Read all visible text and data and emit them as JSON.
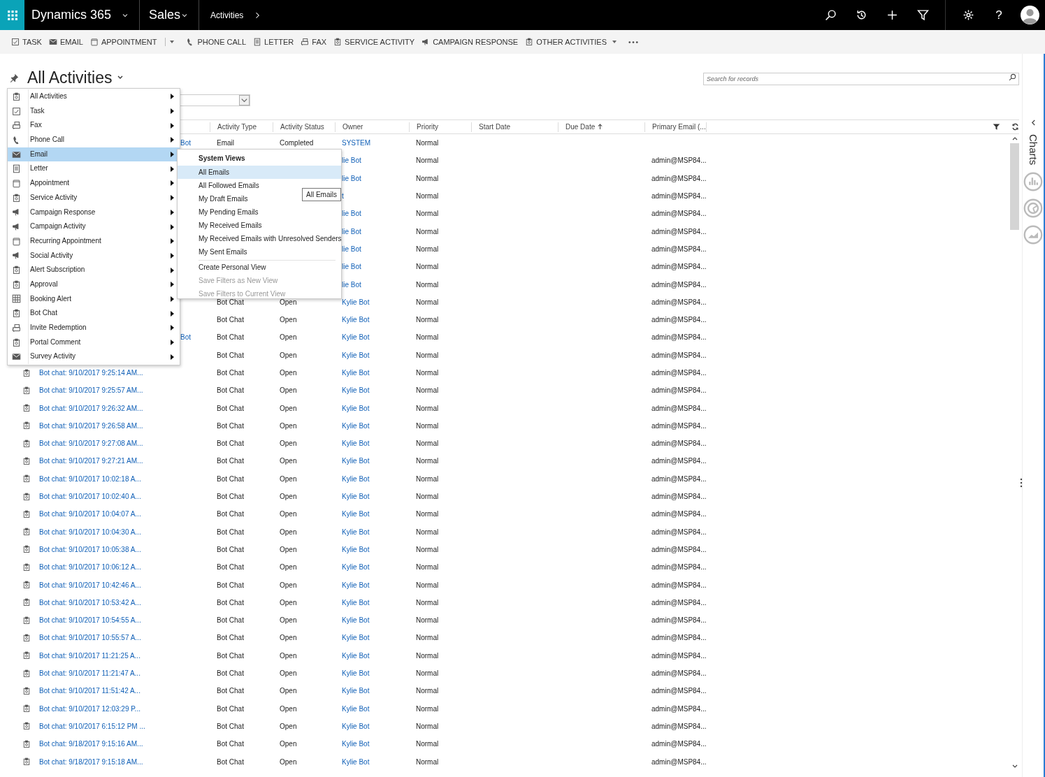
{
  "nav": {
    "app": "Dynamics 365",
    "area": "Sales",
    "entity": "Activities",
    "help": "?"
  },
  "commands": [
    {
      "label": "TASK",
      "kind": "button"
    },
    {
      "label": "EMAIL",
      "kind": "button"
    },
    {
      "label": "APPOINTMENT",
      "kind": "split"
    },
    {
      "label": "PHONE CALL",
      "kind": "button"
    },
    {
      "label": "LETTER",
      "kind": "button"
    },
    {
      "label": "FAX",
      "kind": "button"
    },
    {
      "label": "SERVICE ACTIVITY",
      "kind": "button"
    },
    {
      "label": "CAMPAIGN RESPONSE",
      "kind": "button"
    },
    {
      "label": "OTHER ACTIVITIES",
      "kind": "menu"
    }
  ],
  "view": {
    "title": "All Activities"
  },
  "search": {
    "placeholder": "Search for records"
  },
  "grid": {
    "columns": [
      {
        "label": "Activity Type",
        "sorted": false
      },
      {
        "label": "Activity Status",
        "sorted": false
      },
      {
        "label": "Owner",
        "sorted": false
      },
      {
        "label": "Priority",
        "sorted": false
      },
      {
        "label": "Start Date",
        "sorted": false
      },
      {
        "label": "Due Date",
        "sorted": true
      },
      {
        "label": "Primary Email (...",
        "sorted": false
      }
    ],
    "rows": [
      {
        "kind": "partial",
        "subject": "Bot",
        "type": "Email",
        "status": "Completed",
        "owner": "SYSTEM",
        "priority": "Normal"
      },
      {
        "kind": "partial",
        "owner": "lie Bot",
        "priority": "Normal",
        "email": "admin@MSP84..."
      },
      {
        "kind": "partial",
        "owner": "lie Bot",
        "priority": "Normal",
        "email": "admin@MSP84..."
      },
      {
        "kind": "partial",
        "owner": "t",
        "priority": "Normal",
        "email": "admin@MSP84..."
      },
      {
        "kind": "partial",
        "owner": "lie Bot",
        "priority": "Normal",
        "email": "admin@MSP84..."
      },
      {
        "kind": "partial",
        "owner": "lie Bot",
        "priority": "Normal",
        "email": "admin@MSP84..."
      },
      {
        "kind": "partial",
        "owner": "lie Bot",
        "priority": "Normal",
        "email": "admin@MSP84..."
      },
      {
        "kind": "partial",
        "owner": "lie Bot",
        "priority": "Normal",
        "email": "admin@MSP84..."
      },
      {
        "kind": "partial",
        "owner": "lie Bot",
        "priority": "Normal",
        "email": "admin@MSP84..."
      },
      {
        "kind": "partial",
        "type": "Bot Chat",
        "status": "Open",
        "owner": "Kylie Bot",
        "priority": "Normal",
        "email": "admin@MSP84..."
      },
      {
        "kind": "partial",
        "type": "Bot Chat",
        "status": "Open",
        "owner": "Kylie Bot",
        "priority": "Normal",
        "email": "admin@MSP84..."
      },
      {
        "kind": "partial",
        "subject": "Bot",
        "type": "Bot Chat",
        "status": "Open",
        "owner": "Kylie Bot",
        "priority": "Normal",
        "email": "admin@MSP84..."
      },
      {
        "kind": "partial",
        "type": "Bot Chat",
        "status": "Open",
        "owner": "Kylie Bot",
        "priority": "Normal",
        "email": "admin@MSP84..."
      },
      {
        "kind": "full",
        "subject": "Bot chat: 9/10/2017 9:25:14 AM...",
        "type": "Bot Chat",
        "status": "Open",
        "owner": "Kylie Bot",
        "priority": "Normal",
        "email": "admin@MSP84..."
      },
      {
        "kind": "full",
        "subject": "Bot chat: 9/10/2017 9:25:57 AM...",
        "type": "Bot Chat",
        "status": "Open",
        "owner": "Kylie Bot",
        "priority": "Normal",
        "email": "admin@MSP84..."
      },
      {
        "kind": "full",
        "subject": "Bot chat: 9/10/2017 9:26:32 AM...",
        "type": "Bot Chat",
        "status": "Open",
        "owner": "Kylie Bot",
        "priority": "Normal",
        "email": "admin@MSP84..."
      },
      {
        "kind": "full",
        "subject": "Bot chat: 9/10/2017 9:26:58 AM...",
        "type": "Bot Chat",
        "status": "Open",
        "owner": "Kylie Bot",
        "priority": "Normal",
        "email": "admin@MSP84..."
      },
      {
        "kind": "full",
        "subject": "Bot chat: 9/10/2017 9:27:08 AM...",
        "type": "Bot Chat",
        "status": "Open",
        "owner": "Kylie Bot",
        "priority": "Normal",
        "email": "admin@MSP84..."
      },
      {
        "kind": "full",
        "subject": "Bot chat: 9/10/2017 9:27:21 AM...",
        "type": "Bot Chat",
        "status": "Open",
        "owner": "Kylie Bot",
        "priority": "Normal",
        "email": "admin@MSP84..."
      },
      {
        "kind": "full",
        "subject": "Bot chat: 9/10/2017 10:02:18 A...",
        "type": "Bot Chat",
        "status": "Open",
        "owner": "Kylie Bot",
        "priority": "Normal",
        "email": "admin@MSP84..."
      },
      {
        "kind": "full",
        "subject": "Bot chat: 9/10/2017 10:02:40 A...",
        "type": "Bot Chat",
        "status": "Open",
        "owner": "Kylie Bot",
        "priority": "Normal",
        "email": "admin@MSP84..."
      },
      {
        "kind": "full",
        "subject": "Bot chat: 9/10/2017 10:04:07 A...",
        "type": "Bot Chat",
        "status": "Open",
        "owner": "Kylie Bot",
        "priority": "Normal",
        "email": "admin@MSP84..."
      },
      {
        "kind": "full",
        "subject": "Bot chat: 9/10/2017 10:04:30 A...",
        "type": "Bot Chat",
        "status": "Open",
        "owner": "Kylie Bot",
        "priority": "Normal",
        "email": "admin@MSP84..."
      },
      {
        "kind": "full",
        "subject": "Bot chat: 9/10/2017 10:05:38 A...",
        "type": "Bot Chat",
        "status": "Open",
        "owner": "Kylie Bot",
        "priority": "Normal",
        "email": "admin@MSP84..."
      },
      {
        "kind": "full",
        "subject": "Bot chat: 9/10/2017 10:06:12 A...",
        "type": "Bot Chat",
        "status": "Open",
        "owner": "Kylie Bot",
        "priority": "Normal",
        "email": "admin@MSP84..."
      },
      {
        "kind": "full",
        "subject": "Bot chat: 9/10/2017 10:42:46 A...",
        "type": "Bot Chat",
        "status": "Open",
        "owner": "Kylie Bot",
        "priority": "Normal",
        "email": "admin@MSP84..."
      },
      {
        "kind": "full",
        "subject": "Bot chat: 9/10/2017 10:53:42 A...",
        "type": "Bot Chat",
        "status": "Open",
        "owner": "Kylie Bot",
        "priority": "Normal",
        "email": "admin@MSP84..."
      },
      {
        "kind": "full",
        "subject": "Bot chat: 9/10/2017 10:54:55 A...",
        "type": "Bot Chat",
        "status": "Open",
        "owner": "Kylie Bot",
        "priority": "Normal",
        "email": "admin@MSP84..."
      },
      {
        "kind": "full",
        "subject": "Bot chat: 9/10/2017 10:55:57 A...",
        "type": "Bot Chat",
        "status": "Open",
        "owner": "Kylie Bot",
        "priority": "Normal",
        "email": "admin@MSP84..."
      },
      {
        "kind": "full",
        "subject": "Bot chat: 9/10/2017 11:21:25 A...",
        "type": "Bot Chat",
        "status": "Open",
        "owner": "Kylie Bot",
        "priority": "Normal",
        "email": "admin@MSP84..."
      },
      {
        "kind": "full",
        "subject": "Bot chat: 9/10/2017 11:21:47 A...",
        "type": "Bot Chat",
        "status": "Open",
        "owner": "Kylie Bot",
        "priority": "Normal",
        "email": "admin@MSP84..."
      },
      {
        "kind": "full",
        "subject": "Bot chat: 9/10/2017 11:51:42 A...",
        "type": "Bot Chat",
        "status": "Open",
        "owner": "Kylie Bot",
        "priority": "Normal",
        "email": "admin@MSP84..."
      },
      {
        "kind": "full",
        "subject": "Bot chat: 9/10/2017 12:03:29 P...",
        "type": "Bot Chat",
        "status": "Open",
        "owner": "Kylie Bot",
        "priority": "Normal",
        "email": "admin@MSP84..."
      },
      {
        "kind": "full",
        "subject": "Bot chat: 9/10/2017 6:15:12 PM ...",
        "type": "Bot Chat",
        "status": "Open",
        "owner": "Kylie Bot",
        "priority": "Normal",
        "email": "admin@MSP84..."
      },
      {
        "kind": "full",
        "subject": "Bot chat: 9/18/2017 9:15:16 AM...",
        "type": "Bot Chat",
        "status": "Open",
        "owner": "Kylie Bot",
        "priority": "Normal",
        "email": "admin@MSP84..."
      },
      {
        "kind": "full",
        "subject": "Bot chat: 9/18/2017 9:15:18 AM...",
        "type": "Bot Chat",
        "status": "Open",
        "owner": "Kylie Bot",
        "priority": "Normal",
        "email": "admin@MSP84..."
      }
    ]
  },
  "menu": {
    "items": [
      {
        "label": "All Activities",
        "selected": false
      },
      {
        "label": "Task",
        "selected": false
      },
      {
        "label": "Fax",
        "selected": false
      },
      {
        "label": "Phone Call",
        "selected": false
      },
      {
        "label": "Email",
        "selected": true
      },
      {
        "label": "Letter",
        "selected": false
      },
      {
        "label": "Appointment",
        "selected": false
      },
      {
        "label": "Service Activity",
        "selected": false
      },
      {
        "label": "Campaign Response",
        "selected": false
      },
      {
        "label": "Campaign Activity",
        "selected": false
      },
      {
        "label": "Recurring Appointment",
        "selected": false
      },
      {
        "label": "Social Activity",
        "selected": false
      },
      {
        "label": "Alert Subscription",
        "selected": false
      },
      {
        "label": "Approval",
        "selected": false
      },
      {
        "label": "Booking Alert",
        "selected": false
      },
      {
        "label": "Bot Chat",
        "selected": false
      },
      {
        "label": "Invite Redemption",
        "selected": false
      },
      {
        "label": "Portal Comment",
        "selected": false
      },
      {
        "label": "Survey Activity",
        "selected": false
      }
    ]
  },
  "submenu": {
    "heading": "System Views",
    "views": [
      {
        "label": "All Emails",
        "selected": true
      },
      {
        "label": "All Followed Emails",
        "selected": false
      },
      {
        "label": "My Draft Emails",
        "selected": false
      },
      {
        "label": "My Pending Emails",
        "selected": false
      },
      {
        "label": "My Received Emails",
        "selected": false
      },
      {
        "label": "My Received Emails with Unresolved Senders",
        "selected": false
      },
      {
        "label": "My Sent Emails",
        "selected": false
      }
    ],
    "actions": [
      {
        "label": "Create Personal View",
        "disabled": false
      },
      {
        "label": "Save Filters as New View",
        "disabled": true
      },
      {
        "label": "Save Filters to Current View",
        "disabled": true
      }
    ]
  },
  "tooltip": {
    "text": "All Emails"
  },
  "charts_pane": {
    "label": "Charts"
  }
}
